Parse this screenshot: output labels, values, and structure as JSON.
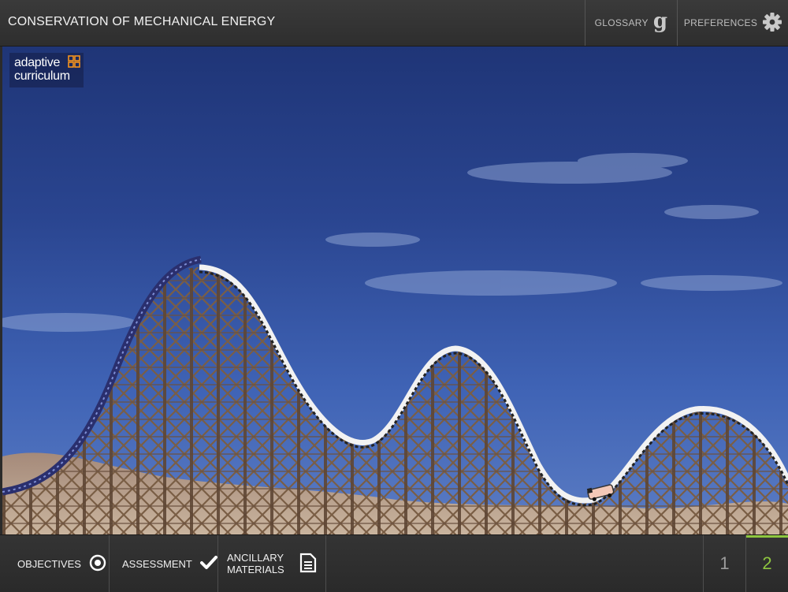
{
  "header": {
    "title": "CONSERVATION OF MECHANICAL ENERGY",
    "glossary_label": "GLOSSARY",
    "preferences_label": "PREFERENCES",
    "glossary_icon": "glossary-g-icon",
    "preferences_icon": "gear-icon"
  },
  "logo": {
    "line1": "adaptive",
    "line2": "curriculum",
    "accent_color": "#f7941d"
  },
  "footer": {
    "objectives_label": "OBJECTIVES",
    "assessment_label": "ASSESSMENT",
    "ancillary_line1": "ANCILLARY",
    "ancillary_line2": "MATERIALS",
    "pages": [
      {
        "label": "1",
        "active": false
      },
      {
        "label": "2",
        "active": true
      }
    ],
    "active_page_color": "#8ec63f"
  }
}
